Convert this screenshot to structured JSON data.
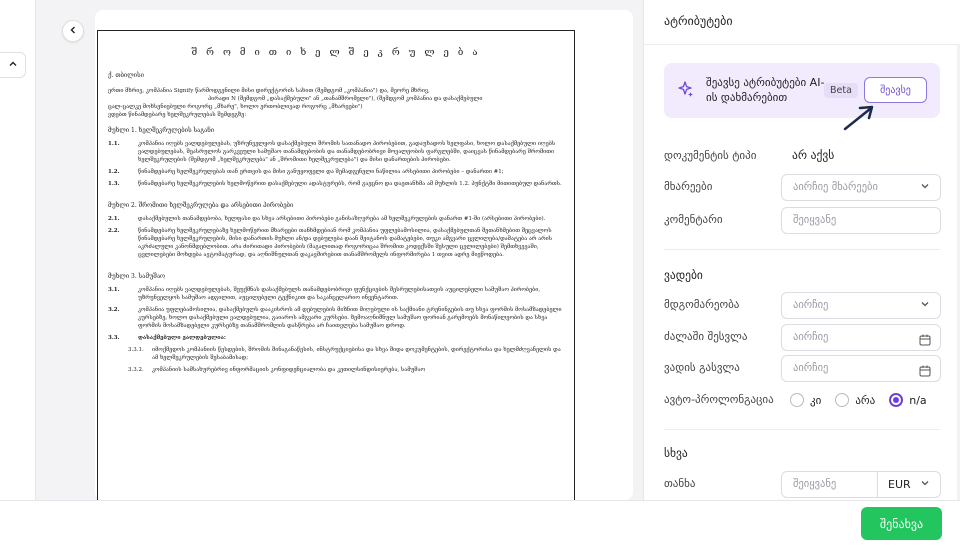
{
  "left_rail": {
    "toggle_icon": "chevron-up-icon"
  },
  "main": {
    "collapse_icon": "chevron-left-icon"
  },
  "document": {
    "title": "შ რ ო მ ი თ ი   ხ ე ლ შ ე კ რ უ ლ ე ბ ა",
    "city": "ქ. თბილისი",
    "intro_1": "ერთი მხრივ, კომპანია Signify წარმოდგენილი მისი დირექტორის სახით (შემდგომ „კომპანია\") და, მეორე მხრივ,",
    "intro_2": "პირადი N (შემდგომ „დასაქმებული\" ან „თანამშრომელი\"), (შემდგომ კომპანია და დასაქმებული",
    "intro_3": "ცალ-ცალკე მოხსენიებული როგორც „მხარე\", ხოლო ერთობლივად როგორც „მხარეები\")",
    "intro_4": "ვდებთ წინამდებარე ხელშეკრულებას შემდეგზე:",
    "article_1": "მუხლი 1. ხელშეკრულების საგანი",
    "item_1_1_num": "1.1.",
    "item_1_1": "კომპანია იღებს ვალდებულებას, უზრუნველყოს დასაქმებული შრომის სათანადო პირობებით, გადაუხადოს ხელფასი, ხოლო დასაქმებული იღებს ვალდებულებას, შეასრულოს გარკვეული სამუშაო თანამდებობის და თანამდებობრივი მოვალეობის ფარგლებში, დაიცვას წინამდებარე შრომითი ხელშეკრულების (შემდგომ „ხელშეკრულება\" ან „შრომითი ხელშეკრულება\") და მისი დანართების პირობები.",
    "item_1_2_num": "1.2.",
    "item_1_2": "წინამდებარე ხელშეკრულებას თან ერთვის და მისი განუყოფელი და შემადგენელი ნაწილია არსებითი პირობები – დანართი #1;",
    "item_1_3_num": "1.3.",
    "item_1_3": "წინამდებარე ხელშეკრულების ხელმოწერით დასაქმებული ადასტურებს, რომ გაეცნო და დაეთანხმა ამ მუხლის 1.2. პუნქტში მითითებულ დანართს.",
    "article_2": "მუხლი 2. შრომითი ხელშეკრულება და არსებითი პირობები",
    "item_2_1_num": "2.1.",
    "item_2_1": "დასაქმებულის თანამდებობა, ხელფასი და სხვა არსებითი პირობები განისაზღვრება ამ ხელშეკრულების დანართ #1-ში (არსებითი პირობები).",
    "item_2_2_num": "2.2.",
    "item_2_2": "წინამდებარე ხელშეკრულებაზე ხელმოწერით მხარეები თანხმდებიან რომ კომპანია უფლებამოსილია, დასაქმებულთან შეთანხმებით შეცვალოს წინამდებარე ხელშეკრულების, მისი დანართის მუხლი ან/და დებულება დაან შეიტანოს დამატებები, თუკი ამგვარი ცვლილება/დამატება არ არის აკრძალული კანონმდებლობით. არა ძირითადი პირობების (მაგალითად როგორიცაა შრომით კოდექსში შესული ცვლილებები) შემთხვევაში, ცვლილებები მოხდება ავტომატურად, და აღნიშნულთან დაკავშირებით თანამშრომელს ინფორმირება 1 თვით ადრე მიეწოდება.",
    "article_3": "მუხლი 3. სამუშაო",
    "item_3_1_num": "3.1.",
    "item_3_1": "კომპანია იღებს ვალდებულებას, შეუქმნას დასაქმებულს თანამდებობრივი ფუნქციების შესრულებისათვის აუცილებელი სამუშაო პირობები, უზრუნველყოს სამუშაო ადგილით, აუცილებელი ტექნიკით და საკანცელარიო ინვენტარით.",
    "item_3_2_num": "3.2.",
    "item_3_2": "კომპანია უფლებამოსილია, დასაქმებულს დააკისროს ამ დებულების მიზნით მიღებული ის საქმიანი ტრენინგების თუ სხვა ფორმის მოსამზადებელი კურსებზე, ხოლო დასაქმებული ვალდებულია, გაიაროს ამგვარი კურსები. ზემოაღნიშნულ სამუშაო ფორიან გარემოებს მონაწილეობის და სხვა ფორმის მოსამზადებელი კურსებზე თანამშრომლის დასწრება არ ჩაითვლება სამუშაო დროდ.",
    "item_3_3_num": "3.3.",
    "item_3_3": "დასაქმებული ვალდებულია:",
    "item_3_3_1_num": "3.3.1.",
    "item_3_3_1": "იმოქმედოს კომპანიის წესდების, შრომის შინაგანაწესის, ინსტრუქციებისა და სხვა შიდა დოკუმენტების, დირექტორისა და ხელმძღვანელის და ამ ხელშეკრულების შესაბამისად;",
    "item_3_3_2_num": "3.3.2.",
    "item_3_3_2": "კომპანიის სამსახურებრივ ინფორმაციის კონფიდენციალობა და კეთილსინდისიერება, სამუშაო"
  },
  "panel": {
    "title": "ატრიბუტები",
    "ai": {
      "icon": "sparkle-icon",
      "text": "შეავსე ატრიბუტები AI-ის დახმარებით",
      "beta": "Beta",
      "button": "შეავსე"
    },
    "doc_type_label": "დოკუმენტის ტიპი",
    "doc_type_value": "არ აქვს",
    "parties_label": "მხარეები",
    "parties_placeholder": "აირჩიე მხარეები",
    "comment_label": "კომენტარი",
    "comment_placeholder": "შეიყვანე",
    "dates_title": "ვადები",
    "status_label": "მდგომარეობა",
    "status_placeholder": "აირჩიე",
    "effective_label": "ძალაში შესვლა",
    "effective_placeholder": "აირჩიე",
    "expiry_label": "ვადის გასვლა",
    "expiry_placeholder": "აირჩიე",
    "auto_label": "ავტო-პროლონგაცია",
    "auto_options": {
      "yes": "კი",
      "no": "არა",
      "na": "n/a"
    },
    "auto_selected": "n/a",
    "other_title": "სხვა",
    "amount_label": "თანხა",
    "amount_placeholder": "შეიყვანე",
    "currency": "EUR"
  },
  "footer": {
    "save_label": "შენახვა"
  },
  "colors": {
    "accent": "#6d3ee0",
    "save": "#22c55e",
    "ai_bg": "#f1ebfd"
  }
}
